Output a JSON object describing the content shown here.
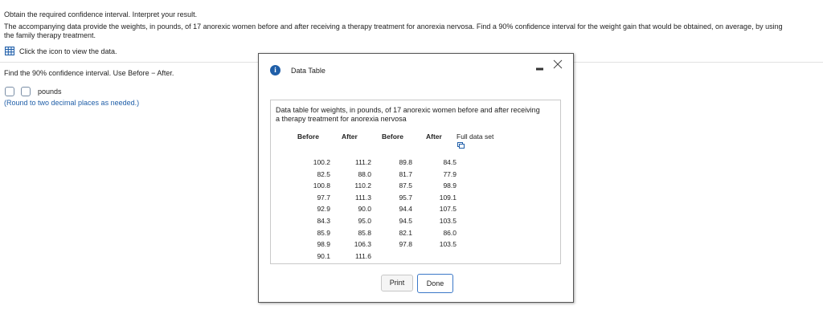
{
  "question": {
    "title": "Obtain the required confidence interval. Interpret your result.",
    "body_line1": "The accompanying data provide the weights, in pounds, of 17 anorexic women before and after receiving a therapy treatment for anorexia nervosa. Find a 90% confidence interval for the weight gain that would be obtained, on average, by using",
    "body_line2": "the family therapy treatment.",
    "data_link": "Click the icon to view the data.",
    "prompt": "Find the 90% confidence interval. Use Before − After.",
    "unit": "pounds",
    "hint": "(Round to two decimal places as needed.)"
  },
  "dialog": {
    "title": "Data Table",
    "caption_line1": "Data table for weights, in pounds, of 17 anorexic women before and after receiving",
    "caption_line2": "a therapy treatment for anorexia nervosa",
    "headers": [
      "Before",
      "After",
      "Before",
      "After"
    ],
    "full_data": "Full data set",
    "col1": [
      "100.2",
      "82.5",
      "100.8",
      "97.7",
      "92.9",
      "84.3",
      "85.9",
      "98.9",
      "90.1"
    ],
    "col2": [
      "111.2",
      "88.0",
      "110.2",
      "111.3",
      "90.0",
      "95.0",
      "85.8",
      "106.3",
      "111.6"
    ],
    "col3": [
      "89.8",
      "81.7",
      "87.5",
      "95.7",
      "94.4",
      "94.5",
      "82.1",
      "97.8"
    ],
    "col4": [
      "84.5",
      "77.9",
      "98.9",
      "109.1",
      "107.5",
      "103.5",
      "86.0",
      "103.5"
    ],
    "print_label": "Print",
    "done_label": "Done"
  },
  "colors": {
    "link_blue": "#1f5ea8",
    "hint_blue": "#1f5ea8",
    "done_border": "#3b78c8"
  }
}
